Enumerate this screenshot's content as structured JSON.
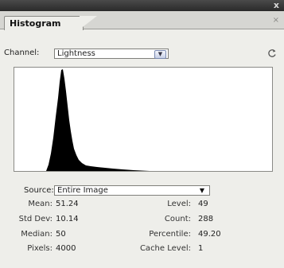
{
  "window": {
    "close_glyph": "x"
  },
  "panel": {
    "tab_title": "Histogram",
    "tab_close_glyph": "×"
  },
  "channel": {
    "label": "Channel:",
    "value": "Lightness"
  },
  "source": {
    "label": "Source:",
    "value": "Entire Image"
  },
  "stats": {
    "mean_label": "Mean:",
    "mean_value": "51.24",
    "std_label": "Std Dev:",
    "std_value": "10.14",
    "median_label": "Median:",
    "median_value": "50",
    "pixels_label": "Pixels:",
    "pixels_value": "4000",
    "level_label": "Level:",
    "level_value": "49",
    "count_label": "Count:",
    "count_value": "288",
    "percentile_label": "Percentile:",
    "percentile_value": "49.20",
    "cache_label": "Cache Level:",
    "cache_value": "1"
  },
  "icons": {
    "refresh": "refresh-icon",
    "dropdown": "chevron-down-icon"
  },
  "colors": {
    "histogram_fill": "#000000",
    "panel_bg": "#eeeeea",
    "titlebar": "#333333"
  }
}
